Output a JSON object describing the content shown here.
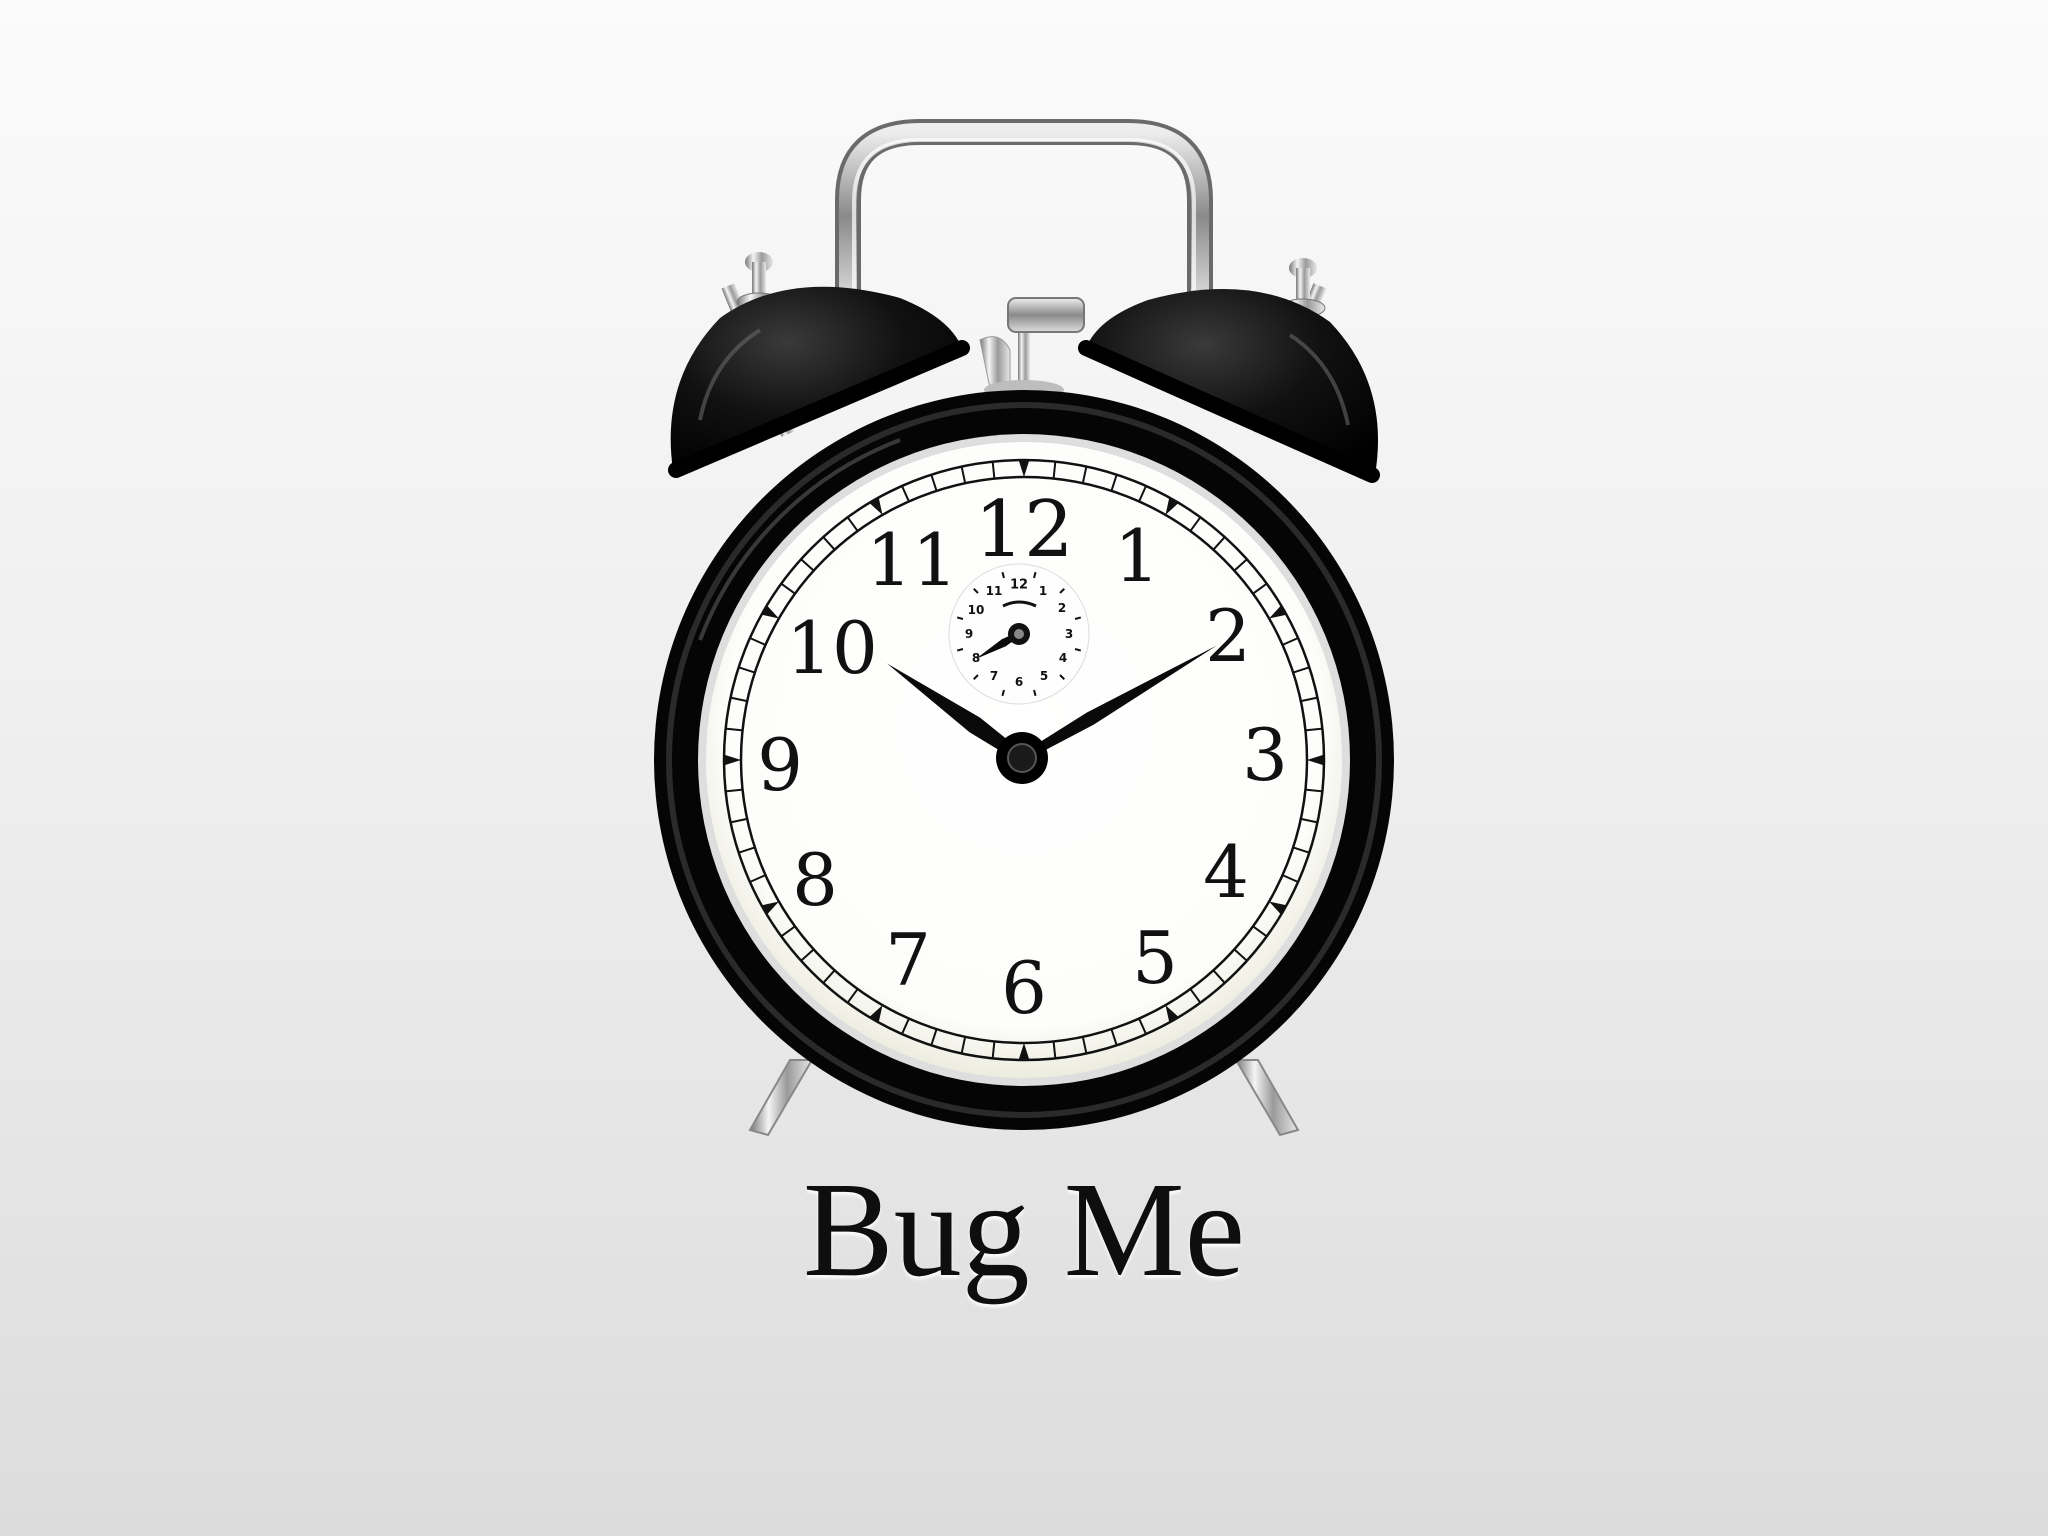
{
  "app": {
    "title": "Bug Me"
  },
  "clock": {
    "icon": "alarm-clock-icon",
    "hour_numerals": [
      "12",
      "1",
      "2",
      "3",
      "4",
      "5",
      "6",
      "7",
      "8",
      "9",
      "10",
      "11"
    ],
    "alarm_dial_numerals": [
      "12",
      "1",
      "2",
      "3",
      "4",
      "5",
      "6",
      "7",
      "8",
      "9",
      "10",
      "11"
    ],
    "time_shown": "10:10",
    "alarm_setting": "8:00",
    "colors": {
      "body": "#0b0b0b",
      "face": "#ffffff",
      "chrome": "#c8c8c8"
    }
  }
}
